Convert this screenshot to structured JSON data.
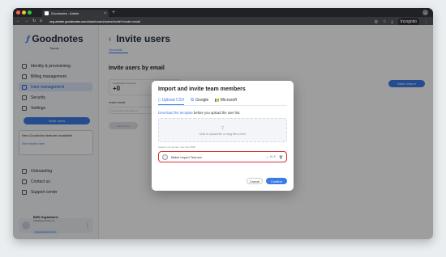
{
  "browser": {
    "tab_title": "Goodnotes - Admin",
    "url_host": "org-admin.goodnotes.com",
    "url_path": "/dashboard/users/invite?mode=email",
    "incognito_label": "Incognito"
  },
  "sidebar": {
    "brand": "Goodnotes",
    "brand_sub": "Teams",
    "items": [
      {
        "label": "Identity & provisioning"
      },
      {
        "label": "Billing management"
      },
      {
        "label": "User management"
      },
      {
        "label": "Security"
      },
      {
        "label": "Settings"
      }
    ],
    "invite_button": "Invite users",
    "promo_title": "New Goodnotes features available!",
    "promo_link": "See what's new",
    "lower_items": [
      {
        "label": "Onboarding"
      },
      {
        "label": "Contact us"
      },
      {
        "label": "Support center"
      }
    ],
    "profile": {
      "name": "B2B OrgAdmin1",
      "email": "b2b@goodnotes.inc",
      "role": "Organization Admin"
    }
  },
  "main": {
    "title": "Invite users",
    "subtab": "Via email",
    "section_title": "Invite users by email",
    "batch_import_button": "Batch Import",
    "stats_label": "Organization licenses",
    "stats_value": "+0",
    "stats_value2": "+0",
    "invite_email_label": "Invite email",
    "email_placeholder": "Input emails (separate w...",
    "send_button": "Send invites"
  },
  "modal": {
    "title": "Import and invite team members",
    "tabs": [
      {
        "label": "Upload CSV"
      },
      {
        "label": "Google"
      },
      {
        "label": "Microsoft"
      }
    ],
    "instruction_link": "Download the template",
    "instruction_rest": "before you upload the user list.",
    "dropzone_text": "Click to upload file or drag file to here",
    "support_text": "Support csv format, max size 5MB",
    "file_name": "Batch Import Test.csv",
    "file_size": "84 B",
    "cancel_button": "Cancel",
    "confirm_button": "Confirm"
  }
}
